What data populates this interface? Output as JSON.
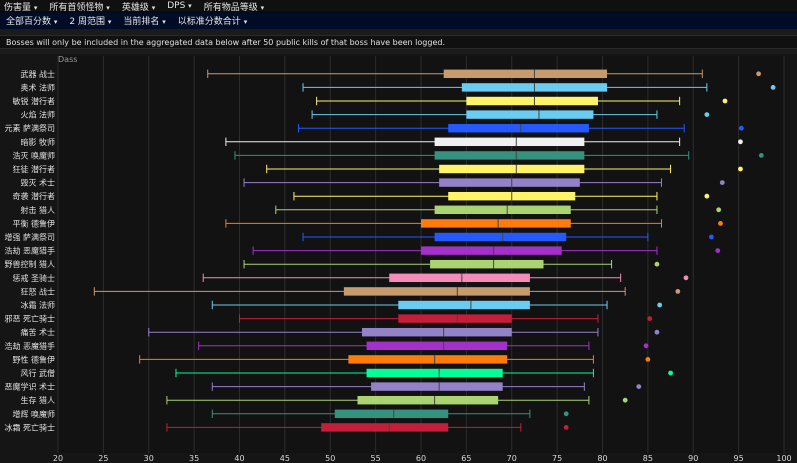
{
  "nav": {
    "top": [
      {
        "label": "伤害量"
      },
      {
        "label": "所有首领怪物"
      },
      {
        "label": "英雄级"
      },
      {
        "label": "DPS"
      },
      {
        "label": "所有物品等级"
      }
    ],
    "sub": [
      {
        "label": "全部百分数"
      },
      {
        "label": "2 周范围"
      },
      {
        "label": "当前排名"
      },
      {
        "label": "以标准分数合计"
      }
    ],
    "caret": "▾"
  },
  "banner": "Bosses will only be included in the aggregated data below after 50 public kills of that boss have been logged.",
  "chart_data": {
    "type": "boxplot",
    "title": "Dass",
    "xlim": [
      20,
      100
    ],
    "x_ticks": [
      20,
      25,
      30,
      35,
      40,
      45,
      50,
      55,
      60,
      65,
      70,
      75,
      80,
      85,
      90,
      95,
      100
    ],
    "grid": true,
    "series": [
      {
        "name": "武器 战士",
        "color": "#c69b6d",
        "min": 36.5,
        "q1": 62.5,
        "median": 72.5,
        "q3": 80.5,
        "max": 91,
        "outlier": 97.2
      },
      {
        "name": "奥术 法师",
        "color": "#69ccf0",
        "min": 47,
        "q1": 64.5,
        "median": 72.5,
        "q3": 80.5,
        "max": 91.5,
        "outlier": 98.8
      },
      {
        "name": "敏锐 潜行者",
        "color": "#fff468",
        "min": 48.5,
        "q1": 65,
        "median": 72.5,
        "q3": 79.5,
        "max": 88.5,
        "outlier": 93.5
      },
      {
        "name": "火焰 法师",
        "color": "#69ccf0",
        "min": 48,
        "q1": 65,
        "median": 73,
        "q3": 79,
        "max": 86,
        "outlier": 91.5
      },
      {
        "name": "元素 萨满祭司",
        "color": "#2459ff",
        "min": 46.5,
        "q1": 63,
        "median": 71,
        "q3": 78.5,
        "max": 89,
        "outlier": 95.3
      },
      {
        "name": "暗影 牧师",
        "color": "#f0f0f0",
        "min": 38.5,
        "q1": 61.5,
        "median": 70.5,
        "q3": 78,
        "max": 88.5,
        "outlier": 95.2
      },
      {
        "name": "浩灭 唤魔师",
        "color": "#33937f",
        "min": 39.5,
        "q1": 61.5,
        "median": 70.5,
        "q3": 78,
        "max": 89.5,
        "outlier": 97.5
      },
      {
        "name": "狂徒 潜行者",
        "color": "#fff468",
        "min": 43,
        "q1": 62,
        "median": 70.5,
        "q3": 78,
        "max": 87.5,
        "outlier": 95.2
      },
      {
        "name": "毁灭 术士",
        "color": "#9482c9",
        "min": 40.5,
        "q1": 62,
        "median": 70,
        "q3": 77.5,
        "max": 86.5,
        "outlier": 93.2
      },
      {
        "name": "奇袭 潜行者",
        "color": "#fff468",
        "min": 46,
        "q1": 63,
        "median": 70,
        "q3": 77,
        "max": 86,
        "outlier": 91.5
      },
      {
        "name": "射击 猎人",
        "color": "#aad372",
        "min": 44,
        "q1": 61.5,
        "median": 69.5,
        "q3": 76.5,
        "max": 86,
        "outlier": 92.8
      },
      {
        "name": "平衡 德鲁伊",
        "color": "#ff7c0a",
        "min": 38.5,
        "q1": 60,
        "median": 68.5,
        "q3": 76.5,
        "max": 86.5,
        "outlier": 93
      },
      {
        "name": "增强 萨满祭司",
        "color": "#2459ff",
        "min": 47,
        "q1": 61.5,
        "median": 69,
        "q3": 76,
        "max": 85,
        "outlier": 92
      },
      {
        "name": "浩劫 恶魔猎手",
        "color": "#a330c9",
        "min": 41.5,
        "q1": 60,
        "median": 68,
        "q3": 75.5,
        "max": 86,
        "outlier": 92.7
      },
      {
        "name": "野兽控制 猎人",
        "color": "#aad372",
        "min": 40.5,
        "q1": 61,
        "median": 68,
        "q3": 73.5,
        "max": 81,
        "outlier": 86
      },
      {
        "name": "惩戒 圣骑士",
        "color": "#f48cba",
        "min": 36,
        "q1": 56.5,
        "median": 64.5,
        "q3": 72,
        "max": 82,
        "outlier": 89.2
      },
      {
        "name": "狂怒 战士",
        "color": "#c69b6d",
        "min": 24,
        "q1": 51.5,
        "median": 64,
        "q3": 72,
        "max": 82.5,
        "outlier": 88.3
      },
      {
        "name": "冰霜 法师",
        "color": "#69ccf0",
        "min": 37,
        "q1": 57.5,
        "median": 65.5,
        "q3": 72,
        "max": 80.5,
        "outlier": 86.3
      },
      {
        "name": "邪恶 死亡骑士",
        "color": "#c41e3a",
        "min": 40,
        "q1": 57.5,
        "median": 64,
        "q3": 70,
        "max": 79.5,
        "outlier": 85.2
      },
      {
        "name": "痛苦 术士",
        "color": "#9482c9",
        "min": 30,
        "q1": 53.5,
        "median": 62.5,
        "q3": 70,
        "max": 79.5,
        "outlier": 86
      },
      {
        "name": "浩劫 恶魔猎手",
        "color": "#a330c9",
        "min": 35.5,
        "q1": 54,
        "median": 62.5,
        "q3": 69.5,
        "max": 78.5,
        "outlier": 84.8
      },
      {
        "name": "野性 德鲁伊",
        "color": "#ff7c0a",
        "min": 29,
        "q1": 52,
        "median": 61.5,
        "q3": 69.5,
        "max": 79,
        "outlier": 85
      },
      {
        "name": "风行 武僧",
        "color": "#00ff98",
        "min": 33,
        "q1": 54,
        "median": 62,
        "q3": 69,
        "max": 79,
        "outlier": 87.5
      },
      {
        "name": "恶魔学识 术士",
        "color": "#9482c9",
        "min": 37,
        "q1": 54.5,
        "median": 62,
        "q3": 69,
        "max": 78,
        "outlier": 84
      },
      {
        "name": "生存 猎人",
        "color": "#aad372",
        "min": 32,
        "q1": 53,
        "median": 61.5,
        "q3": 68.5,
        "max": 78.5,
        "outlier": 82.5
      },
      {
        "name": "增辉 唤魔师",
        "color": "#33937f",
        "min": 37,
        "q1": 50.5,
        "median": 57,
        "q3": 63,
        "max": 72,
        "outlier": 76
      },
      {
        "name": "冰霜 死亡骑士",
        "color": "#c41e3a",
        "min": 32,
        "q1": 49,
        "median": 56.5,
        "q3": 63,
        "max": 71,
        "outlier": 76
      }
    ]
  }
}
